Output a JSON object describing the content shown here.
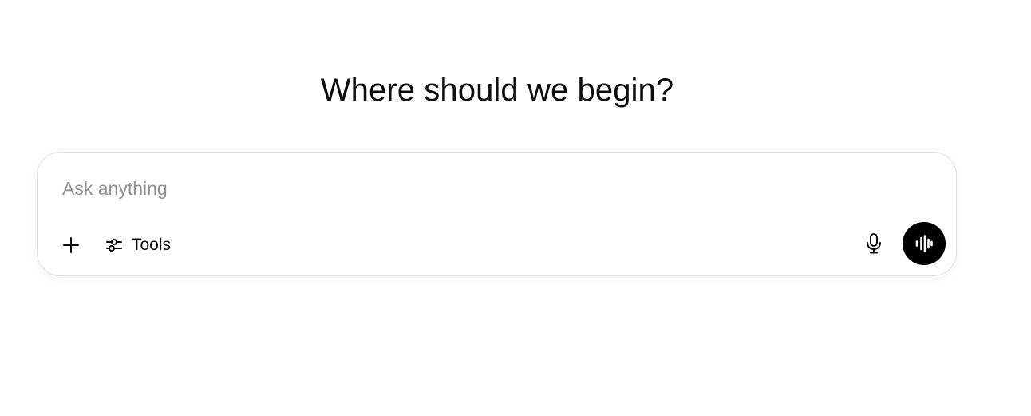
{
  "heading": "Where should we begin?",
  "composer": {
    "placeholder": "Ask anything",
    "value": ""
  },
  "toolbar": {
    "add_icon": "plus-icon",
    "tools_icon": "sliders-icon",
    "tools_label": "Tools",
    "mic_icon": "microphone-icon",
    "voice_icon": "voice-waveform-icon"
  },
  "colors": {
    "text": "#0d0d0d",
    "placeholder": "#8f8f8f",
    "border": "#e3e3e3",
    "voice_button_bg": "#000000",
    "voice_button_fg": "#ffffff"
  }
}
